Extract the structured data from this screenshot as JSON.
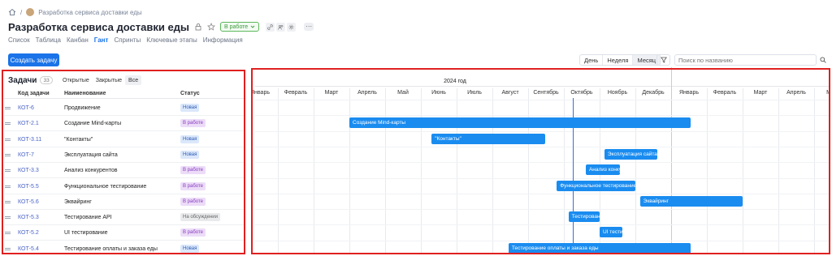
{
  "breadcrumb": {
    "separator": "/",
    "project": "Разработка сервиса доставки еды"
  },
  "header": {
    "title": "Разработка сервиса доставки еды",
    "status": "В работе",
    "more": "···"
  },
  "view_tabs": [
    {
      "label": "Список",
      "active": false
    },
    {
      "label": "Таблица",
      "active": false
    },
    {
      "label": "Канбан",
      "active": false
    },
    {
      "label": "Гант",
      "active": true
    },
    {
      "label": "Спринты",
      "active": false
    },
    {
      "label": "Ключевые этапы",
      "active": false
    },
    {
      "label": "Информация",
      "active": false
    }
  ],
  "toolbar": {
    "create_label": "Создать задачу",
    "scale": [
      "День",
      "Неделя",
      "Месяц"
    ],
    "scale_active": "Месяц",
    "search_placeholder": "Поиск по названию"
  },
  "tasks": {
    "title": "Задачи",
    "count": "33",
    "filters": [
      "Открытые",
      "Закрытые",
      "Все"
    ],
    "filter_active": "Все",
    "columns": {
      "code": "Код задачи",
      "name": "Наименование",
      "status": "Статус"
    },
    "rows": [
      {
        "code": "КОТ-6",
        "name": "Продвижение",
        "status": "Новая",
        "status_kind": "new"
      },
      {
        "code": "КОТ-2.1",
        "name": "Создание Mind-карты",
        "status": "В работе",
        "status_kind": "work"
      },
      {
        "code": "КОТ-3.11",
        "name": "\"Контакты\"",
        "status": "Новая",
        "status_kind": "new"
      },
      {
        "code": "КОТ-7",
        "name": "Эксплуатация сайта",
        "status": "Новая",
        "status_kind": "new"
      },
      {
        "code": "КОТ-3.3",
        "name": "Анализ конкурентов",
        "status": "В работе",
        "status_kind": "work"
      },
      {
        "code": "КОТ-5.5",
        "name": "Функциональное тестирование",
        "status": "В работе",
        "status_kind": "work"
      },
      {
        "code": "КОТ-5.6",
        "name": "Эквайринг",
        "status": "В работе",
        "status_kind": "work"
      },
      {
        "code": "КОТ-5.3",
        "name": "Тестирование API",
        "status": "На обсуждении",
        "status_kind": "disc"
      },
      {
        "code": "КОТ-5.2",
        "name": "UI тестирование",
        "status": "В работе",
        "status_kind": "work"
      },
      {
        "code": "КОТ-5.4",
        "name": "Тестирование оплаты и заказа еды",
        "status": "Новая",
        "status_kind": "new"
      }
    ]
  },
  "gantt": {
    "year_label": "2024 год",
    "months": [
      "Январь",
      "Февраль",
      "Март",
      "Апрель",
      "Май",
      "Июнь",
      "Июль",
      "Август",
      "Сентябрь",
      "Октябрь",
      "Ноябрь",
      "Декабрь",
      "Январь",
      "Февраль",
      "Март",
      "Апрель",
      "Май"
    ],
    "bars": [
      {
        "row": 1,
        "label": "Создание Mind-карты",
        "start": "2024-04-01",
        "end": "2025-01-18"
      },
      {
        "row": 2,
        "label": "\"Контакты\"",
        "start": "2024-06-10",
        "end": "2024-09-15"
      },
      {
        "row": 3,
        "label": "Эксплуатация сайта",
        "start": "2024-11-05",
        "end": "2024-12-20"
      },
      {
        "row": 4,
        "label": "Анализ конкурентов",
        "start": "2024-10-20",
        "end": "2024-11-18"
      },
      {
        "row": 5,
        "label": "Функциональное тестирование",
        "start": "2024-09-25",
        "end": "2024-12-01"
      },
      {
        "row": 6,
        "label": "Эквайринг",
        "start": "2024-12-05",
        "end": "2025-03-01"
      },
      {
        "row": 7,
        "label": "Тестирование API",
        "start": "2024-10-05",
        "end": "2024-11-01"
      },
      {
        "row": 8,
        "label": "UI тестирование",
        "start": "2024-11-01",
        "end": "2024-11-20"
      },
      {
        "row": 9,
        "label": "Тестирование оплаты и заказа еды",
        "start": "2024-08-15",
        "end": "2025-01-18"
      }
    ],
    "today": "2024-10-09"
  }
}
